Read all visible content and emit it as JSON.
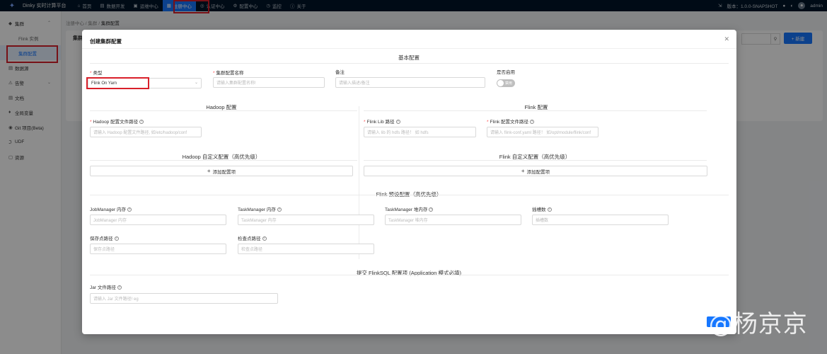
{
  "topbar": {
    "brand": "Dinky 实时计算平台",
    "nav": [
      {
        "label": "首页",
        "icon": "home-icon"
      },
      {
        "label": "数据开发",
        "icon": "code-icon"
      },
      {
        "label": "运维中心",
        "icon": "monitor-icon"
      },
      {
        "label": "注册中心",
        "icon": "registry-icon"
      },
      {
        "label": "认证中心",
        "icon": "shield-icon"
      },
      {
        "label": "配置中心",
        "icon": "gear-icon"
      },
      {
        "label": "监控",
        "icon": "clock-icon"
      },
      {
        "label": "关于",
        "icon": "info-icon"
      }
    ],
    "version": "版本：1.0.0-SNAPSHOT",
    "user": "admin"
  },
  "sidebar": {
    "items": [
      {
        "label": "集群",
        "icon": "cluster-icon"
      },
      {
        "label": "Flink 实例"
      },
      {
        "label": "集群配置"
      },
      {
        "label": "数据源",
        "icon": "database-icon"
      },
      {
        "label": "告警",
        "icon": "alert-icon"
      },
      {
        "label": "文档",
        "icon": "doc-icon"
      },
      {
        "label": "全局变量",
        "icon": "variable-icon"
      },
      {
        "label": "Git 项目(Beta)",
        "icon": "git-icon"
      },
      {
        "label": "UDF",
        "icon": "udf-icon"
      },
      {
        "label": "资源",
        "icon": "resource-icon"
      }
    ]
  },
  "background": {
    "breadcrumb": [
      "注册中心",
      "集群",
      "集群配置"
    ],
    "card_title": "集群",
    "new_button": "+ 新建"
  },
  "modal": {
    "title": "创建集群配置",
    "basic_section": "基本配置",
    "type_label": "类型",
    "type_value": "Flink On Yarn",
    "name_label": "集群配置名称",
    "name_placeholder": "请输入集群配置名称!",
    "note_label": "备注",
    "note_placeholder": "请输入描述/备注",
    "enabled_label": "是否启用",
    "enabled_toggle": "禁用",
    "hadoop_section": "Hadoop 配置",
    "hadoop_conf_label": "Hadoop 配置文件路径",
    "hadoop_conf_placeholder": "请输入 Hadoop 配置文件路径, 如/etc/hadoop/conf",
    "hadoop_custom_section": "Hadoop 自定义配置（高优先级）",
    "hadoop_add_btn": "添加配置项",
    "flink_section": "Flink 配置",
    "flink_lib_label": "Flink Lib 路径",
    "flink_lib_placeholder": "请输入 lib 的 hdfs 路径！ 如 hdfs",
    "flink_conf_label": "Flink 配置文件路径",
    "flink_conf_placeholder": "请输入 flink-conf.yaml 路径！ 如/opt/module/flink/conf",
    "flink_custom_section": "Flink 自定义配置（高优先级）",
    "flink_add_btn": "添加配置项",
    "preset_section": "Flink 预设配置（高优先级）",
    "jm_label": "JobManager 内存",
    "jm_placeholder": "JobManager 内存",
    "tm_label": "TaskManager 内存",
    "tm_placeholder": "TaskManager 内存",
    "tm_heap_label": "TaskManager 堆内存",
    "tm_heap_placeholder": "TaskManager 堆内存",
    "slots_label": "插槽数",
    "slots_placeholder": "插槽数",
    "savepoint_label": "保存点路径",
    "savepoint_placeholder": "保存点路径",
    "checkpoint_label": "检查点路径",
    "checkpoint_placeholder": "检查点路径",
    "flinksql_section": "提交 FlinkSQL 配置项 (Application 模式必填)",
    "jar_label": "Jar 文件路径",
    "jar_placeholder": "请输入 Jar 文件路径! eg"
  },
  "watermark": "知乎 @杨京京",
  "colors": {
    "primary": "#1677ff",
    "topbar": "#001529",
    "highlight": "#d9202a"
  }
}
